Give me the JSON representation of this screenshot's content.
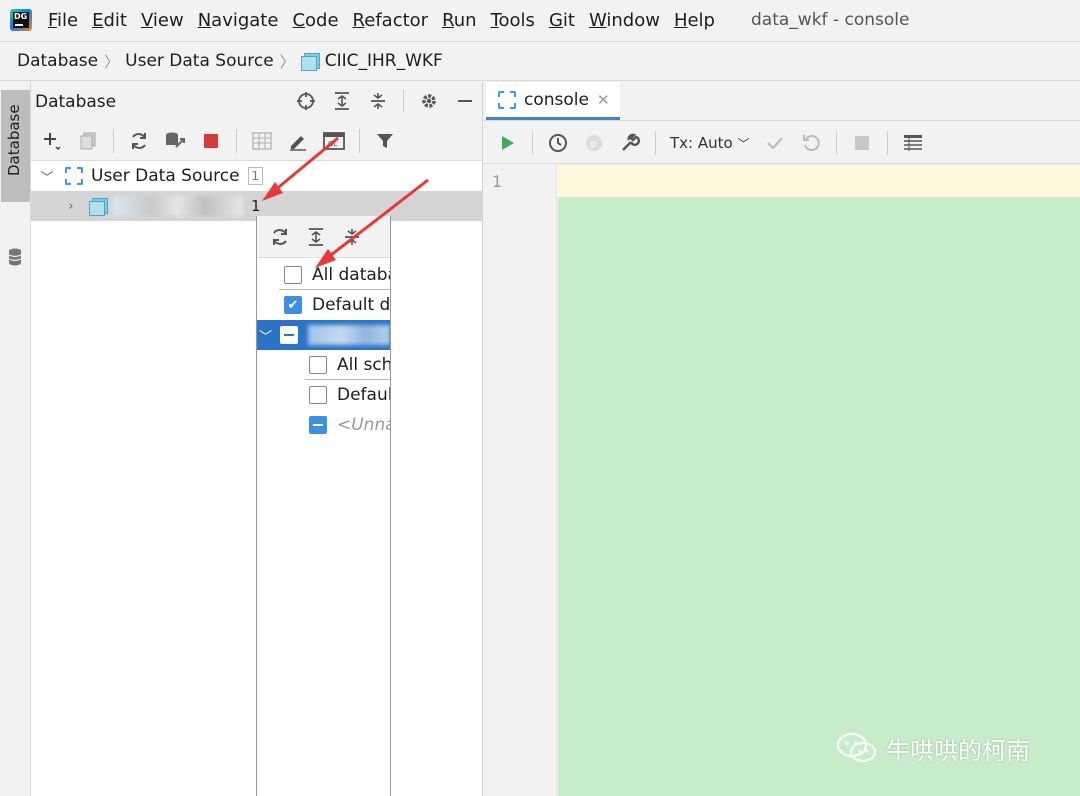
{
  "app": {
    "logo_text": "DG",
    "window_title": "data_wkf - console"
  },
  "menu": [
    {
      "mnemonic": "F",
      "rest": "ile"
    },
    {
      "mnemonic": "E",
      "rest": "dit"
    },
    {
      "mnemonic": "V",
      "rest": "iew"
    },
    {
      "mnemonic": "N",
      "rest": "avigate"
    },
    {
      "mnemonic": "C",
      "rest": "ode"
    },
    {
      "mnemonic": "R",
      "rest": "efactor"
    },
    {
      "mnemonic": "R",
      "rest": "un"
    },
    {
      "mnemonic": "T",
      "rest": "ools"
    },
    {
      "mnemonic": "G",
      "rest": "it"
    },
    {
      "mnemonic": "W",
      "rest": "indow"
    },
    {
      "mnemonic": "H",
      "rest": "elp"
    }
  ],
  "breadcrumb": {
    "items": [
      "Database",
      "User Data Source",
      "CIIC_IHR_WKF"
    ]
  },
  "tool_strip": {
    "tab_label": "Database"
  },
  "db_panel": {
    "title": "Database",
    "tree": {
      "root_label": "User Data Source",
      "root_count": "1",
      "child_count": "1"
    }
  },
  "filter_popup": {
    "rows": {
      "all_databases": "All databa",
      "default_database": "Default da",
      "all_schemas": "All sch",
      "default_schema": "Defaul",
      "unnamed": "<Unna"
    }
  },
  "editor": {
    "tab_label": "console",
    "tx_mode": "Tx: Auto",
    "line_number": "1"
  },
  "watermark": {
    "text": "牛哄哄的柯南"
  },
  "colors": {
    "selection_blue": "#2b73c7",
    "checkbox_blue": "#3d8fe2",
    "code_bg": "#c7ecca",
    "current_line": "#fdf8dd",
    "arrow_red": "#e53935",
    "run_green": "#3dae5b",
    "stop_red": "#d83b3b"
  }
}
